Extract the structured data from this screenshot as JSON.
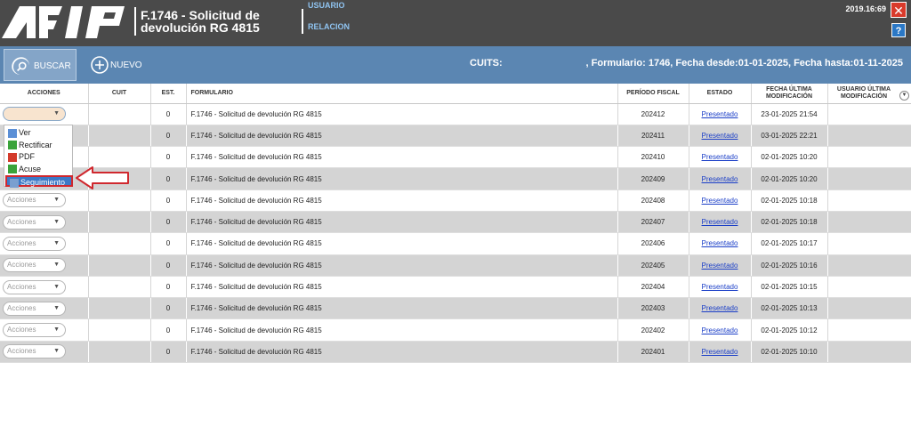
{
  "header": {
    "form_title_line1": "F.1746 - Solicitud de",
    "form_title_line2": "devolución RG 4815",
    "nav_usuario": "USUARIO",
    "nav_relacion": "RELACION",
    "clock": "2019.16:69",
    "close_label": "✕",
    "help_label": "?"
  },
  "toolbar": {
    "buscar_label": "BUSCAR",
    "nuevo_label": "NUEVO",
    "cuits_label": "CUITS:",
    "filter_text": ", Formulario: 1746, Fecha desde:01-01-2025, Fecha hasta:01-11-2025"
  },
  "table": {
    "headers": {
      "acciones": "ACCIONES",
      "cuit": "CUIT",
      "est": "EST.",
      "formulario": "FORMULARIO",
      "periodo": "PERÍODO FISCAL",
      "estado": "ESTADO",
      "fecha": "FECHA ÚLTIMA MODIFICACIÓN",
      "usuario": "USUARIO ÚLTIMA MODIFICACIÓN"
    },
    "acciones_placeholder": "Acciones",
    "rows": [
      {
        "est": "0",
        "formulario": "F.1746 - Solicitud de devolución RG 4815",
        "periodo": "202412",
        "estado": "Presentado",
        "fecha": "23-01-2025 21:54"
      },
      {
        "est": "0",
        "formulario": "F.1746 - Solicitud de devolución RG 4815",
        "periodo": "202411",
        "estado": "Presentado",
        "fecha": "03-01-2025 22:21"
      },
      {
        "est": "0",
        "formulario": "F.1746 - Solicitud de devolución RG 4815",
        "periodo": "202410",
        "estado": "Presentado",
        "fecha": "02-01-2025 10:20"
      },
      {
        "est": "0",
        "formulario": "F.1746 - Solicitud de devolución RG 4815",
        "periodo": "202409",
        "estado": "Presentado",
        "fecha": "02-01-2025 10:20"
      },
      {
        "est": "0",
        "formulario": "F.1746 - Solicitud de devolución RG 4815",
        "periodo": "202408",
        "estado": "Presentado",
        "fecha": "02-01-2025 10:18"
      },
      {
        "est": "0",
        "formulario": "F.1746 - Solicitud de devolución RG 4815",
        "periodo": "202407",
        "estado": "Presentado",
        "fecha": "02-01-2025 10:18"
      },
      {
        "est": "0",
        "formulario": "F.1746 - Solicitud de devolución RG 4815",
        "periodo": "202406",
        "estado": "Presentado",
        "fecha": "02-01-2025 10:17"
      },
      {
        "est": "0",
        "formulario": "F.1746 - Solicitud de devolución RG 4815",
        "periodo": "202405",
        "estado": "Presentado",
        "fecha": "02-01-2025 10:16"
      },
      {
        "est": "0",
        "formulario": "F.1746 - Solicitud de devolución RG 4815",
        "periodo": "202404",
        "estado": "Presentado",
        "fecha": "02-01-2025 10:15"
      },
      {
        "est": "0",
        "formulario": "F.1746 - Solicitud de devolución RG 4815",
        "periodo": "202403",
        "estado": "Presentado",
        "fecha": "02-01-2025 10:13"
      },
      {
        "est": "0",
        "formulario": "F.1746 - Solicitud de devolución RG 4815",
        "periodo": "202402",
        "estado": "Presentado",
        "fecha": "02-01-2025 10:12"
      },
      {
        "est": "0",
        "formulario": "F.1746 - Solicitud de devolución RG 4815",
        "periodo": "202401",
        "estado": "Presentado",
        "fecha": "02-01-2025 10:10"
      }
    ]
  },
  "dropdown": {
    "items": [
      {
        "label": "Ver",
        "icon": "document-view-icon"
      },
      {
        "label": "Rectificar",
        "icon": "edit-icon"
      },
      {
        "label": "PDF",
        "icon": "pdf-icon"
      },
      {
        "label": "Acuse",
        "icon": "receipt-icon"
      },
      {
        "label": "Seguimiento",
        "icon": "tracking-icon"
      }
    ],
    "selected_index": 4
  },
  "colors": {
    "header_bg": "#4a4a4a",
    "toolbar_bg": "#5b86b2",
    "alt_row": "#d4d4d4",
    "link": "#1a3ec7",
    "highlight_arrow": "#d0282e"
  }
}
